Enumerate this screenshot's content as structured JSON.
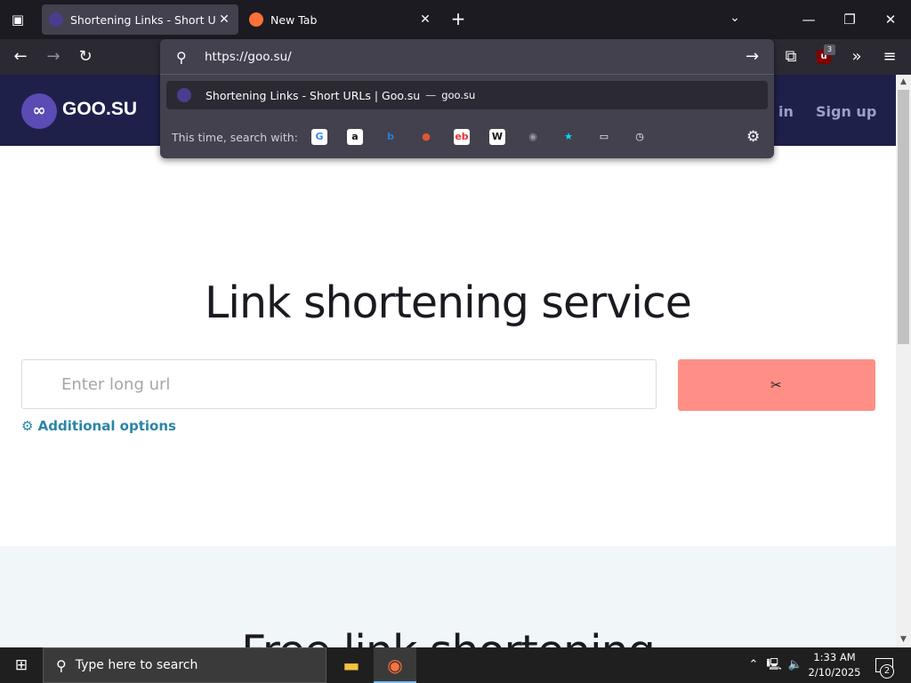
{
  "browser": {
    "tabs": [
      {
        "title": "Shortening Links - Short URLs | Goo.su",
        "active": true
      },
      {
        "title": "New Tab",
        "active": false
      }
    ],
    "tab_close": "✕",
    "new_tab": "+",
    "list_all_tabs": "⌄",
    "window": {
      "minimize": "—",
      "restore": "❐",
      "close": "✕"
    },
    "nav": {
      "back": "←",
      "forward": "→",
      "reload": "↻",
      "extensions": "⧉",
      "overflow": "»",
      "menu": "≡"
    },
    "extension_badge": "3",
    "ublock_icon": "u"
  },
  "urlbar": {
    "value": "https://goo.su/",
    "go": "→",
    "suggestion": {
      "title": "Shortening Links - Short URLs | Goo.su",
      "separator": "—",
      "url": "goo.su"
    },
    "search_with_label": "This time, search with:",
    "engines": [
      {
        "name": "google-icon",
        "glyph": "G",
        "color": "#4285f4",
        "bg": "#ffffff"
      },
      {
        "name": "amazon-icon",
        "glyph": "a",
        "color": "#111111",
        "bg": "#ffffff"
      },
      {
        "name": "bing-icon",
        "glyph": "b",
        "color": "#2a7fd4",
        "bg": "transparent"
      },
      {
        "name": "duckduckgo-icon",
        "glyph": "●",
        "color": "#de5833",
        "bg": "transparent"
      },
      {
        "name": "ebay-icon",
        "glyph": "eb",
        "color": "#e53238",
        "bg": "#ffffff"
      },
      {
        "name": "wikipedia-icon",
        "glyph": "W",
        "color": "#111111",
        "bg": "#ffffff"
      },
      {
        "name": "search-engine-icon",
        "glyph": "◉",
        "color": "#9a9aa4",
        "bg": "transparent"
      },
      {
        "name": "bookmarks-star-icon",
        "glyph": "★",
        "color": "#00ddff",
        "bg": "transparent"
      },
      {
        "name": "tabs-icon",
        "glyph": "▭",
        "color": "#fbfbfe",
        "bg": "transparent"
      },
      {
        "name": "history-icon",
        "glyph": "◷",
        "color": "#fbfbfe",
        "bg": "transparent"
      }
    ],
    "settings": "⚙"
  },
  "site": {
    "logo_text": "GOO.SU",
    "logo_glyph": "∞",
    "signin": "n in",
    "signup": "Sign up",
    "headline": "Link shortening service",
    "input_placeholder": "Enter long url",
    "button_icon": "✂",
    "options_label": "⚙ Additional options",
    "section2_title": "Free link shortening"
  },
  "taskbar": {
    "start": "⊞",
    "search_placeholder": "Type here to search",
    "search_icon": "⚲",
    "apps": [
      {
        "name": "file-explorer-icon",
        "glyph": "▬",
        "color": "#f3c33c"
      },
      {
        "name": "firefox-icon",
        "glyph": "◉",
        "color": "#ff7139"
      }
    ],
    "tray": {
      "chevron": "⌃",
      "network": "🖳",
      "volume": "🔈"
    },
    "time": "1:33 AM",
    "date": "2/10/2025",
    "notifications": "2"
  },
  "colors": {
    "accent": "#ff8f86",
    "header": "#1e2049",
    "link": "#2a85a8"
  }
}
